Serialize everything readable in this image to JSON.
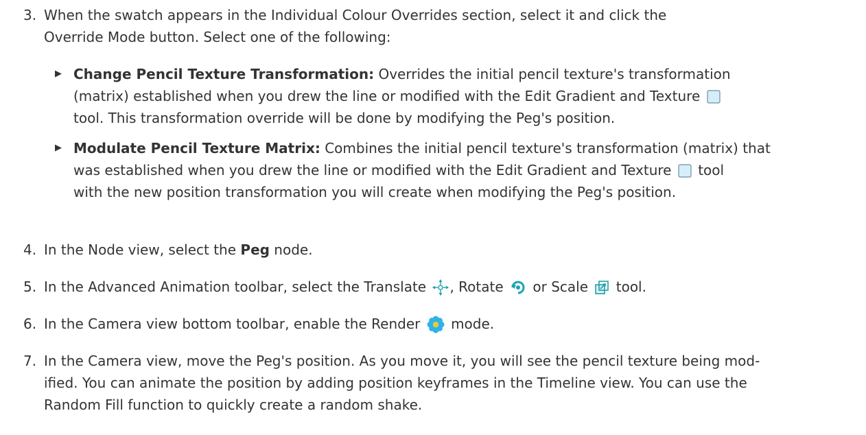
{
  "steps": [
    {
      "num": "3.",
      "line1": "When the swatch appears in the Individual Colour Overrides section, select it and click the",
      "line2": "Override Mode button. Select one of the following:"
    },
    {
      "num": "4.",
      "pre": "In the Node view, select the ",
      "bold": "Peg",
      "post": " node."
    },
    {
      "num": "5.",
      "pre": "In the Advanced Animation toolbar, select the Translate",
      "mid1": ", Rotate",
      "mid2": "or Scale",
      "post": "tool."
    },
    {
      "num": "6.",
      "pre": "In the Camera view bottom toolbar, enable the Render",
      "post": "mode."
    },
    {
      "num": "7.",
      "line1": "In the Camera view, move the Peg's position. As you move it, you will see the pencil texture being mod-",
      "line2": "ified. You can animate the position by adding position keyframes in the Timeline view. You can use the",
      "line3": "Random Fill function to quickly create a random shake."
    }
  ],
  "bullets": [
    {
      "title": "Change Pencil Texture Transformation:",
      "line1": " Overrides the initial pencil texture's transformation",
      "line2": "(matrix) established when you drew the line or modified with the Edit Gradient and Texture",
      "line3": "tool. This transformation override will be done by modifying the Peg's position."
    },
    {
      "title": "Modulate Pencil Texture Matrix:",
      "line1": " Combines the initial pencil texture's transformation (matrix) that",
      "line2": "was established when you drew the line or modified with the Edit Gradient and Texture",
      "line2b": "tool",
      "line3": "with the new position transformation you will create when modifying the Peg's position."
    }
  ],
  "icons": {
    "bullet": "triangle-bullet-icon",
    "edit_gradient": "edit-gradient-texture-icon",
    "translate": "translate-icon",
    "rotate": "rotate-icon",
    "scale": "scale-icon",
    "render": "render-flower-icon"
  },
  "colors": {
    "text": "#333333",
    "gradient_icon_fill": "#d6eef8",
    "gradient_icon_border": "#6a8fa8",
    "rotate_teal": "#1aa3b0",
    "scale_teal": "#1fa0a8",
    "render_blue": "#2fb2e8"
  }
}
